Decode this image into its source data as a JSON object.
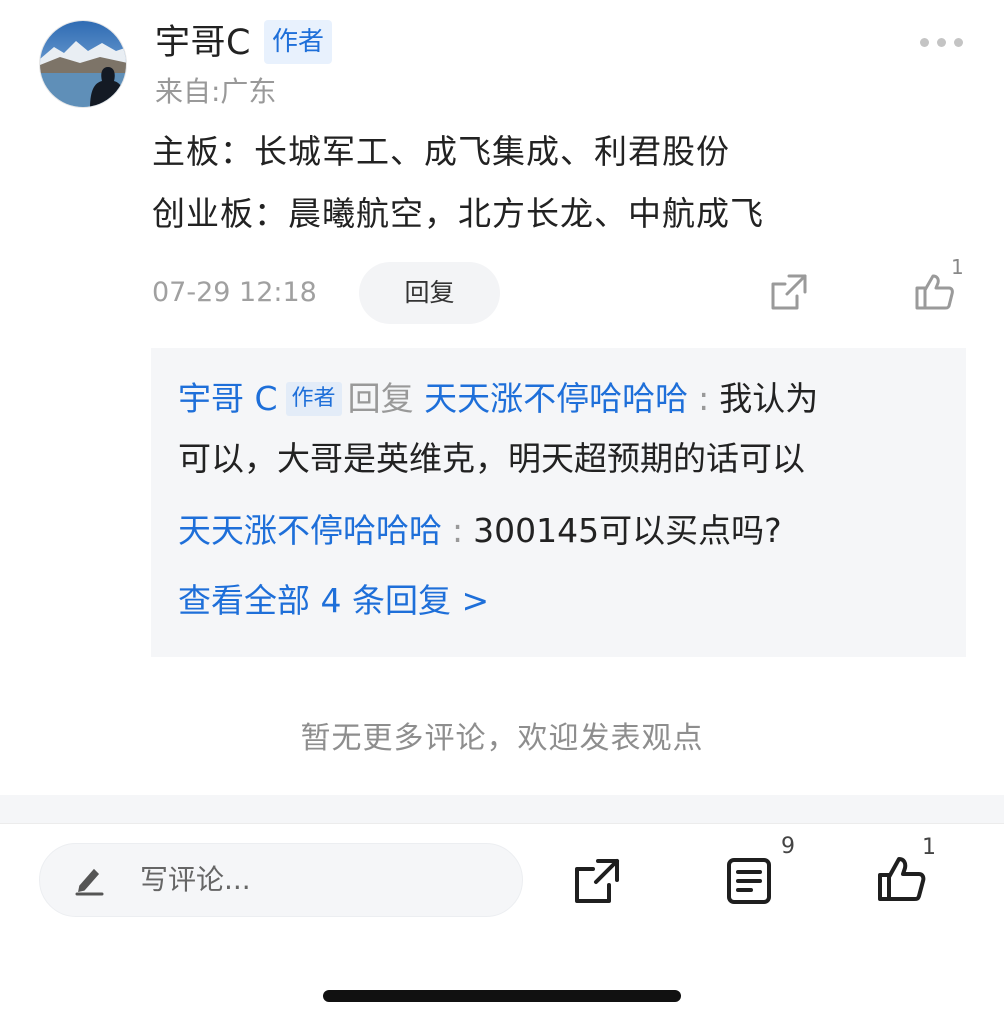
{
  "comment": {
    "username": "宇哥C",
    "author_tag": "作者",
    "location": "来自:广东",
    "content_line1": "主板：长城军工、成飞集成、利君股份",
    "content_line2": "创业板：晨曦航空，北方长龙、中航成飞",
    "timestamp": "07-29 12:18",
    "reply_button": "回复",
    "like_count": "1",
    "icons": {
      "more": "more-dots-icon",
      "share": "share-icon",
      "like": "thumbs-up-icon"
    }
  },
  "replies": {
    "r1_user": "宇哥 C",
    "r1_tag": "作者",
    "r1_action": "回复",
    "r1_target": "天天涨不停哈哈哈",
    "r1_sep": ":",
    "r1_text_part1": "我认为",
    "r1_text_part2": "可以，大哥是英维克，明天超预期的话可以",
    "r2_user": "天天涨不停哈哈哈",
    "r2_sep": ":",
    "r2_text": "300145可以买点吗?",
    "view_all": "查看全部 4 条回复 >"
  },
  "no_more": "暂无更多评论，欢迎发表观点",
  "bottom_bar": {
    "placeholder": "写评论...",
    "comments_count": "9",
    "like_count": "1",
    "icons": {
      "pen": "pen-icon",
      "share": "share-icon",
      "comments": "comments-list-icon",
      "like": "thumbs-up-icon"
    }
  },
  "colors": {
    "link_blue": "#1e6fd9",
    "tag_bg": "#e8f1fd",
    "muted": "#999999",
    "panel_bg": "#f5f6f8"
  }
}
